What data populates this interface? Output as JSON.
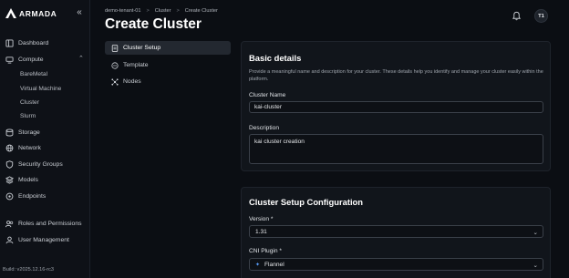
{
  "brand": {
    "name": "ARMADA"
  },
  "sidebar": {
    "collapse_icon": "«",
    "items": [
      {
        "label": "Dashboard",
        "icon": "dashboard-icon"
      },
      {
        "label": "Compute",
        "icon": "compute-icon",
        "expanded": true
      },
      {
        "label": "Storage",
        "icon": "storage-icon"
      },
      {
        "label": "Network",
        "icon": "network-icon"
      },
      {
        "label": "Security Groups",
        "icon": "shield-icon"
      },
      {
        "label": "Models",
        "icon": "models-icon"
      },
      {
        "label": "Endpoints",
        "icon": "endpoints-icon"
      },
      {
        "label": "Roles and Permissions",
        "icon": "roles-icon"
      },
      {
        "label": "User Management",
        "icon": "user-icon"
      }
    ],
    "compute_children": [
      "BareMetal",
      "Virtual Machine",
      "Cluster",
      "Slurm"
    ],
    "build": "Build: v2025.12.16-rc3"
  },
  "breadcrumb": [
    "demo-tenant-01",
    "Cluster",
    "Create Cluster"
  ],
  "breadcrumb_sep": ">",
  "page_title": "Create Cluster",
  "header": {
    "avatar_initials": "T1"
  },
  "steps": [
    {
      "label": "Cluster Setup",
      "active": true
    },
    {
      "label": "Template",
      "active": false
    },
    {
      "label": "Nodes",
      "active": false
    }
  ],
  "basic_details": {
    "title": "Basic details",
    "description": "Provide a meaningful name and description for your cluster. These details help you identify and manage your cluster easily within the platform.",
    "name_label": "Cluster Name",
    "name_value": "kai-cluster",
    "desc_label": "Description",
    "desc_value": "kai cluster creation"
  },
  "setup_config": {
    "title": "Cluster Setup Configuration",
    "version_label": "Version *",
    "version_value": "1.31",
    "cni_label": "CNI Plugin *",
    "cni_value": "Flannel"
  },
  "colors": {
    "background": "#0b0e13",
    "card": "#11151b",
    "active_step": "#232830",
    "accent": "#5aa0ff"
  }
}
